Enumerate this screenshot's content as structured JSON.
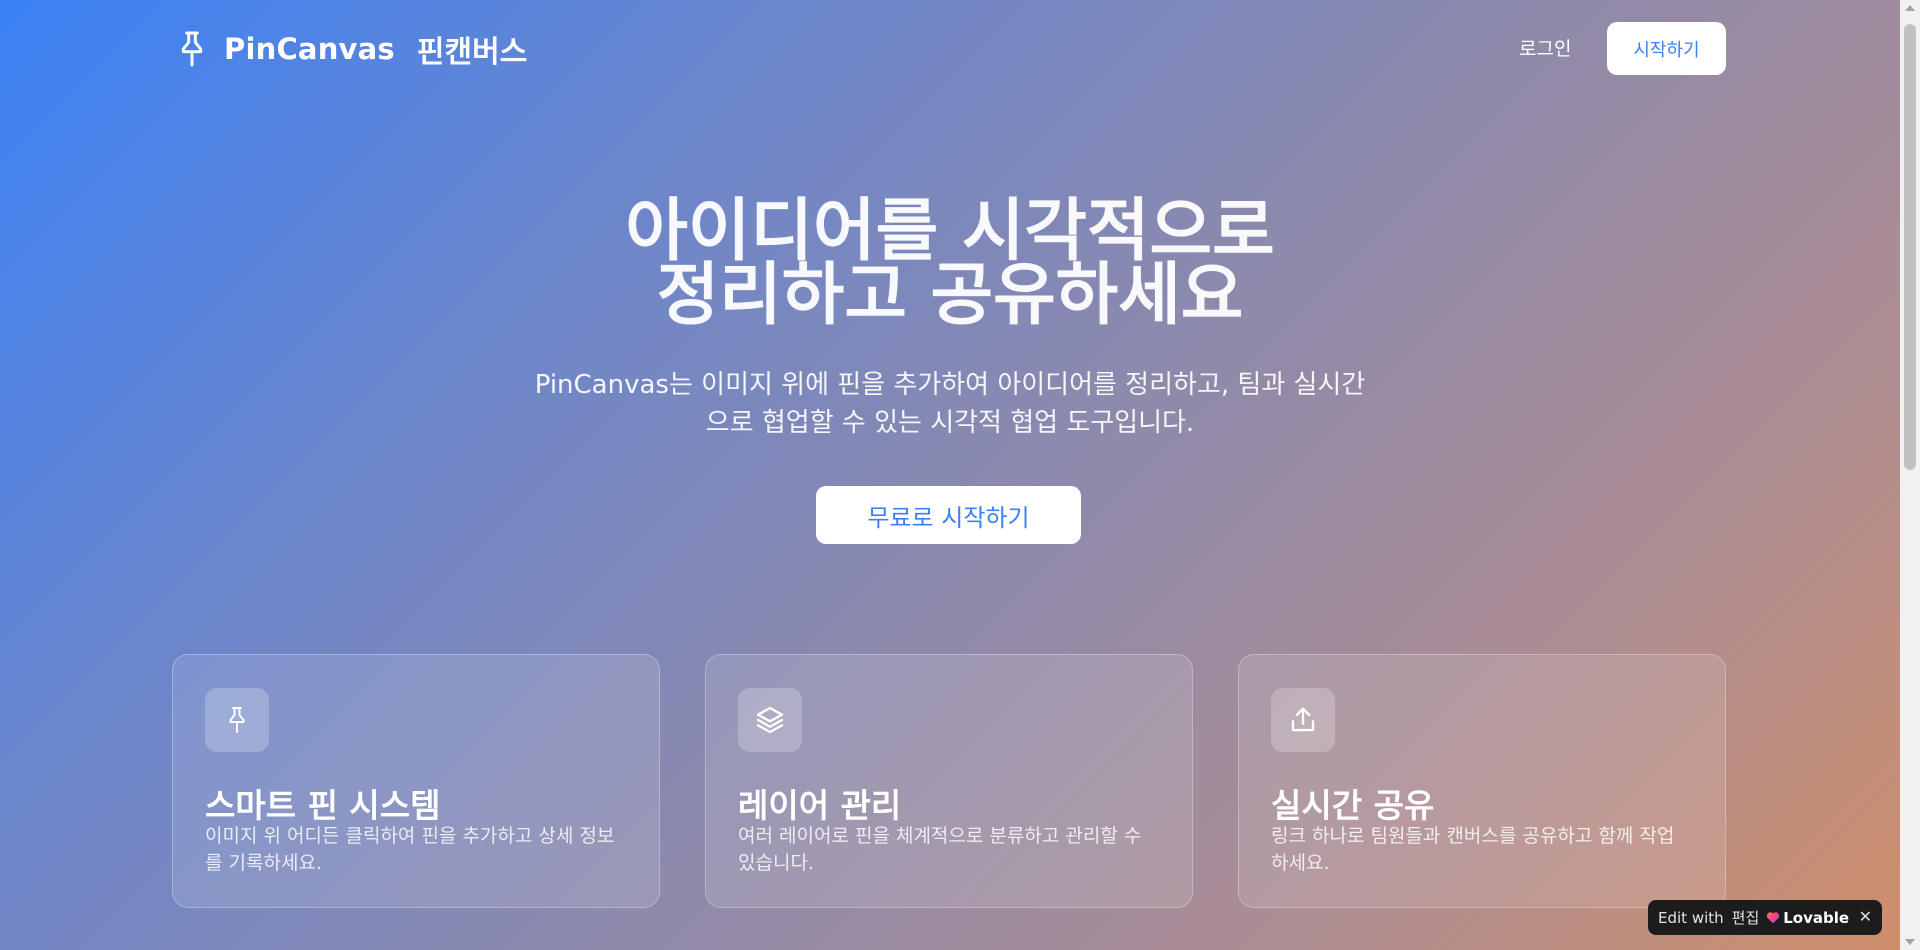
{
  "header": {
    "logo_name": "PinCanvas",
    "logo_name_kr": "핀캔버스",
    "login_label": "로그인",
    "start_label": "시작하기"
  },
  "hero": {
    "title_line1": "아이디어를 시각적으로",
    "title_line2": "정리하고 공유하세요",
    "subtitle_line1": "PinCanvas는 이미지 위에 핀을 추가하여 아이디어를 정리하고, 팀과 실시간",
    "subtitle_line2": "으로 협업할 수 있는 시각적 협업 도구입니다.",
    "cta_label": "무료로 시작하기"
  },
  "features": [
    {
      "icon": "pin-icon",
      "title": "스마트 핀 시스템",
      "desc": "이미지 위 어디든 클릭하여 핀을 추가하고 상세 정보를 기록하세요."
    },
    {
      "icon": "layers-icon",
      "title": "레이어 관리",
      "desc": "여러 레이어로 핀을 체계적으로 분류하고 관리할 수 있습니다."
    },
    {
      "icon": "share-icon",
      "title": "실시간 공유",
      "desc": "링크 하나로 팀원들과 캔버스를 공유하고 함께 작업하세요."
    }
  ],
  "badge": {
    "edit_with": "Edit with",
    "edit_kr": "편집",
    "brand": "Lovable",
    "close": "✕"
  },
  "colors": {
    "accent": "#3b82f6",
    "gradient_start": "#3b82f6",
    "gradient_end": "#cf8e6a",
    "badge_bg": "#1c1c1c"
  }
}
